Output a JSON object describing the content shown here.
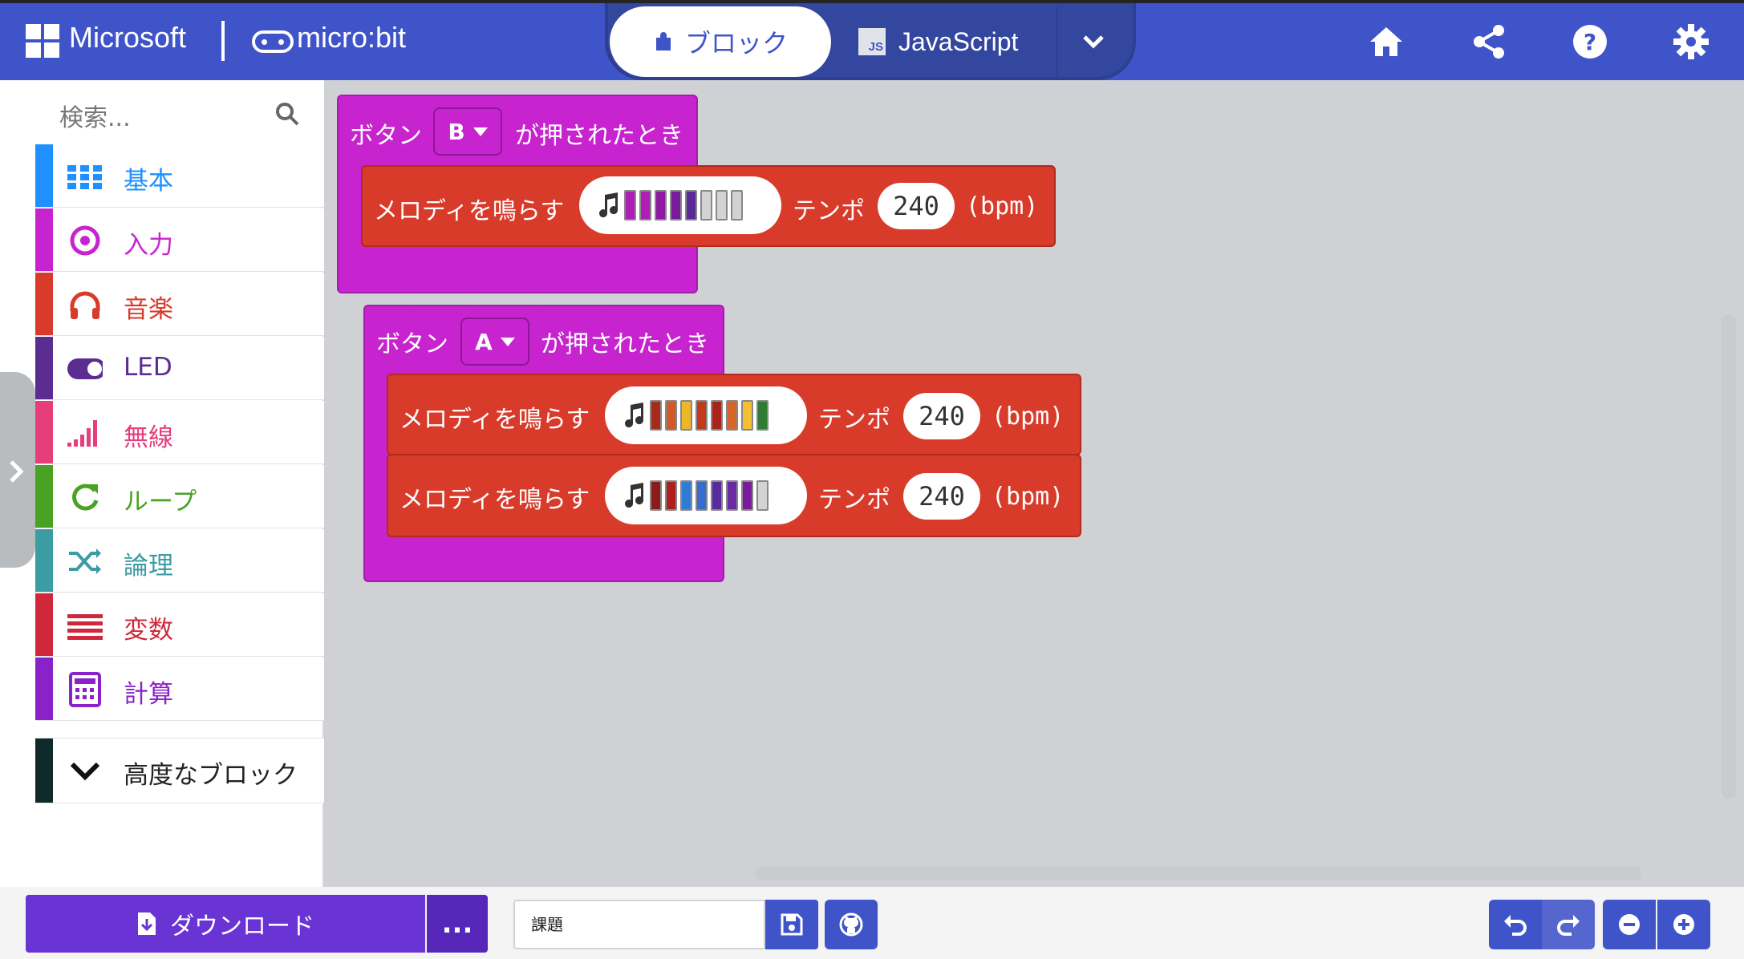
{
  "header": {
    "brand": "Microsoft",
    "product": "micro:bit",
    "tabs": [
      {
        "label": "ブロック",
        "active": true
      },
      {
        "label": "JavaScript",
        "active": false,
        "badge": "JS"
      }
    ],
    "icons": [
      "home-icon",
      "share-icon",
      "help-icon",
      "settings-icon"
    ]
  },
  "sidebar": {
    "search_placeholder": "検索...",
    "categories": [
      {
        "label": "基本",
        "color": "#1e90ff",
        "icon": "grid-icon"
      },
      {
        "label": "入力",
        "color": "#c724d0",
        "icon": "target-icon"
      },
      {
        "label": "音楽",
        "color": "#d93b2b",
        "icon": "headphones-icon"
      },
      {
        "label": "LED",
        "color": "#5c2d91",
        "icon": "toggle-icon"
      },
      {
        "label": "無線",
        "color": "#e63e7b",
        "icon": "signal-bars-icon"
      },
      {
        "label": "ループ",
        "color": "#4aa223",
        "icon": "refresh-icon"
      },
      {
        "label": "論理",
        "color": "#3b9ca3",
        "icon": "shuffle-icon"
      },
      {
        "label": "変数",
        "color": "#d0283a",
        "icon": "list-lines-icon"
      },
      {
        "label": "計算",
        "color": "#8a22c9",
        "icon": "calculator-icon"
      }
    ],
    "advanced": {
      "label": "高度なブロック",
      "color": "#0f2a2a"
    }
  },
  "workspace": {
    "blocks": [
      {
        "event_prefix": "ボタン",
        "button": "B",
        "event_suffix": "が押されたとき",
        "melodies": [
          {
            "label": "メロディを鳴らす",
            "tempo_label": "テンポ",
            "tempo": "240",
            "unit": "(bpm)",
            "notes": [
              "#b01db6",
              "#b01db6",
              "#8e1aa1",
              "#7a1a9c",
              "#5a2a9a",
              "#d3d3d3",
              "#d3d3d3",
              "#d3d3d3"
            ]
          }
        ]
      },
      {
        "event_prefix": "ボタン",
        "button": "A",
        "event_suffix": "が押されたとき",
        "melodies": [
          {
            "label": "メロディを鳴らす",
            "tempo_label": "テンポ",
            "tempo": "240",
            "unit": "(bpm)",
            "notes": [
              "#a82a1a",
              "#cf5a2a",
              "#f0b62a",
              "#c23a1a",
              "#a8241a",
              "#d8642a",
              "#f2c030",
              "#2e7d32"
            ]
          },
          {
            "label": "メロディを鳴らす",
            "tempo_label": "テンポ",
            "tempo": "240",
            "unit": "(bpm)",
            "notes": [
              "#8c1b1b",
              "#b01f1f",
              "#2f7bd6",
              "#3a6ccf",
              "#5a2a9a",
              "#6a2aa6",
              "#7a1a9c",
              "#d3d3d3"
            ]
          }
        ]
      }
    ]
  },
  "footer": {
    "download_label": "ダウンロード",
    "more_label": "...",
    "project_name": "課題"
  }
}
